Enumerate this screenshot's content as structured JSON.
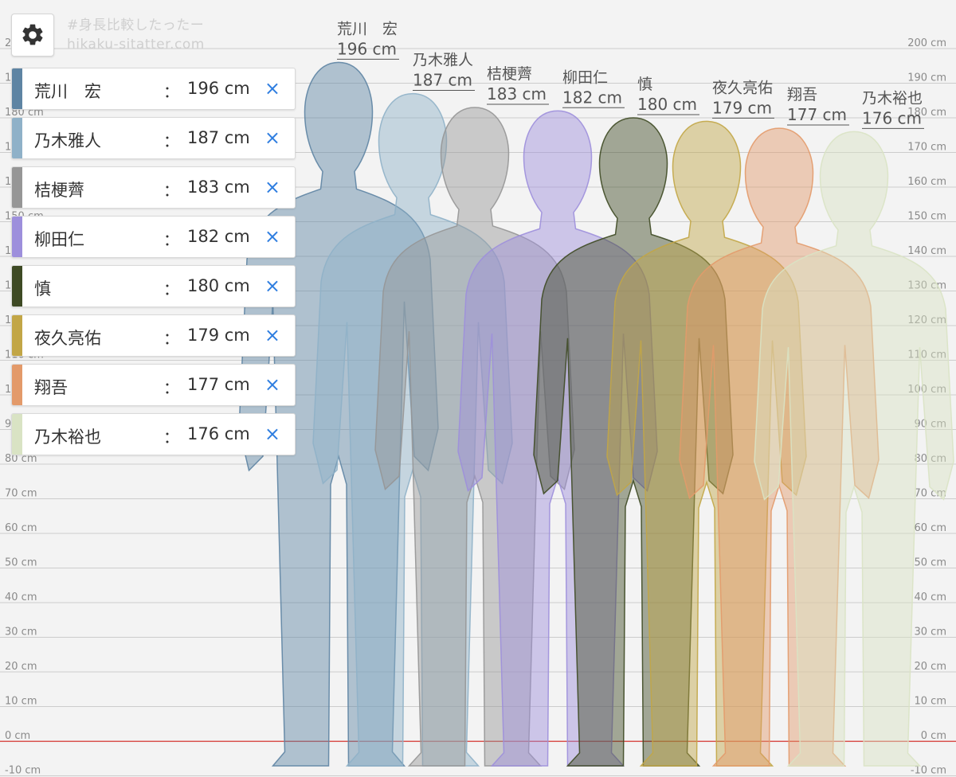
{
  "app": {
    "watermark_line1": "#身長比較したったー",
    "watermark_line2": "hikaku-sitatter.com",
    "settings_icon": "gear-icon",
    "remove_icon": "close-icon"
  },
  "scale": {
    "unit": "cm",
    "min": -10,
    "max": 200,
    "tick_step": 10,
    "ticks": [
      "200 cm",
      "190 cm",
      "180 cm",
      "170 cm",
      "160 cm",
      "150 cm",
      "140 cm",
      "130 cm",
      "120 cm",
      "110 cm",
      "100 cm",
      "90 cm",
      "80 cm",
      "70 cm",
      "60 cm",
      "50 cm",
      "40 cm",
      "30 cm",
      "20 cm",
      "10 cm",
      "0 cm",
      "-10 cm"
    ],
    "baseline_color": "#d9534f"
  },
  "people": [
    {
      "name": "荒川　宏",
      "height": 196,
      "height_label": "196 cm",
      "color": "#5e84a3",
      "remove_label": "×"
    },
    {
      "name": "乃木雅人",
      "height": 187,
      "height_label": "187 cm",
      "color": "#8fb1c8",
      "remove_label": "×"
    },
    {
      "name": "桔梗薺",
      "height": 183,
      "height_label": "183 cm",
      "color": "#969696",
      "remove_label": "×"
    },
    {
      "name": "柳田仁",
      "height": 182,
      "height_label": "182 cm",
      "color": "#9d8fdc",
      "remove_label": "×"
    },
    {
      "name": "慎",
      "height": 180,
      "height_label": "180 cm",
      "color": "#3e4a24",
      "remove_label": "×"
    },
    {
      "name": "夜久亮佑",
      "height": 179,
      "height_label": "179 cm",
      "color": "#c2a646",
      "remove_label": "×"
    },
    {
      "name": "翔吾",
      "height": 177,
      "height_label": "177 cm",
      "color": "#e39a6a",
      "remove_label": "×"
    },
    {
      "name": "乃木裕也",
      "height": 176,
      "height_label": "176 cm",
      "color": "#d9e3c4",
      "remove_label": "×"
    }
  ],
  "legend_separator": "："
}
